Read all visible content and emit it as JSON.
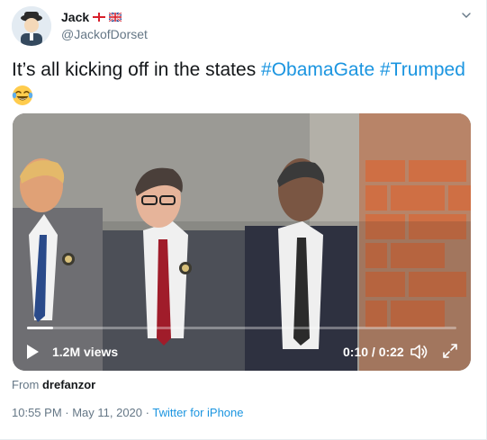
{
  "tweet": {
    "author": {
      "display_name": "Jack",
      "handle": "@JackofDorset",
      "flags": [
        "england-flag-icon",
        "union-jack-icon"
      ]
    },
    "text": {
      "main": "It’s all kicking off in the states",
      "hashtags": [
        "#ObamaGate",
        "#Trumped"
      ],
      "emoji": "face-with-tears-of-joy"
    },
    "media": {
      "views": "1.2M views",
      "time": "0:10 / 0:22",
      "progress": 0.06
    },
    "attribution": {
      "prefix": "From",
      "source": "drefanzor"
    },
    "meta": {
      "timestamp": "10:55 PM · May 11, 2020 ·",
      "client": "Twitter for iPhone"
    }
  },
  "colors": {
    "link": "#1b95e0",
    "text": "#14171a",
    "muted": "#657786"
  }
}
